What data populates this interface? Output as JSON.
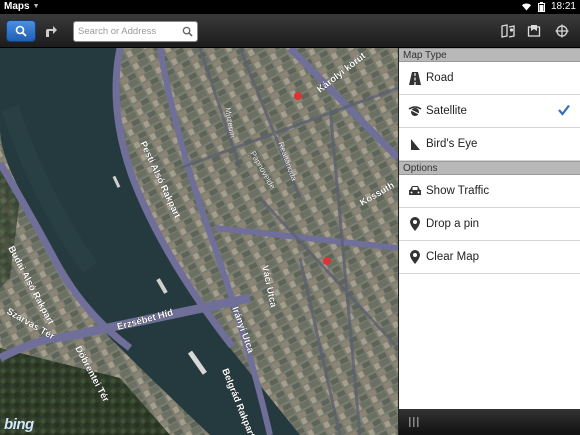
{
  "status_bar": {
    "app_name": "Maps",
    "time": "18:21",
    "icons": [
      "dropdown-caret-icon",
      "wifi-icon",
      "battery-icon"
    ]
  },
  "toolbar": {
    "search_button_icon": "search-icon",
    "directions_button_icon": "directions-icon",
    "search_placeholder": "Search or Address",
    "right_icons": [
      "layers-icon",
      "bookmarks-icon",
      "locate-icon"
    ]
  },
  "map": {
    "attribution": "bing",
    "street_labels": [
      "Károlyi körút",
      "Pesti Alsó Rakpart",
      "Budai Alsó Rakpart",
      "Döbrentei Tér",
      "Erzsébet Híd",
      "Szarvas Tér",
      "Kossuth",
      "Váci Utca",
      "Irányi Utca",
      "Belgrád Rakpart",
      "Reáltanoda",
      "Múzeum",
      "Papnövelde"
    ]
  },
  "panel": {
    "map_type_header": "Map Type",
    "options_header": "Options",
    "map_types": [
      {
        "label": "Road",
        "icon": "road-icon",
        "selected": false
      },
      {
        "label": "Satellite",
        "icon": "satellite-icon",
        "selected": true
      },
      {
        "label": "Bird's Eye",
        "icon": "birds-eye-icon",
        "selected": false
      }
    ],
    "options": [
      {
        "label": "Show Traffic",
        "icon": "car-icon"
      },
      {
        "label": "Drop a pin",
        "icon": "pin-icon"
      },
      {
        "label": "Clear Map",
        "icon": "pin-icon"
      }
    ],
    "check_color": "#2f6fc4"
  }
}
